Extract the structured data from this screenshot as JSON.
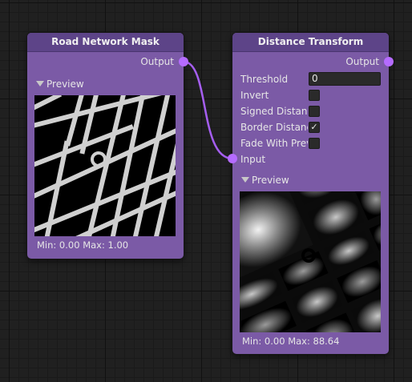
{
  "nodes": {
    "road_mask": {
      "title": "Road Network Mask",
      "output_label": "Output",
      "preview_label": "Preview",
      "minmax": "Min: 0.00 Max: 1.00"
    },
    "distance": {
      "title": "Distance Transform",
      "output_label": "Output",
      "input_label": "Input",
      "preview_label": "Preview",
      "minmax": "Min: 0.00 Max: 88.64",
      "properties": [
        {
          "label": "Threshold",
          "type": "text",
          "value": "0"
        },
        {
          "label": "Invert",
          "type": "checkbox",
          "checked": false
        },
        {
          "label": "Signed Distanc",
          "type": "checkbox",
          "checked": false
        },
        {
          "label": "Border Distanc",
          "type": "checkbox",
          "checked": true
        },
        {
          "label": "Fade With Prev",
          "type": "checkbox",
          "checked": false
        }
      ]
    }
  },
  "colors": {
    "node_body": "#7b5aa6",
    "node_header": "#5d4488",
    "port": "#b56bff",
    "wire": "#a55ef0",
    "canvas": "#202020"
  },
  "icons": {
    "check": "✓",
    "collapse": "triangle-down-icon"
  }
}
